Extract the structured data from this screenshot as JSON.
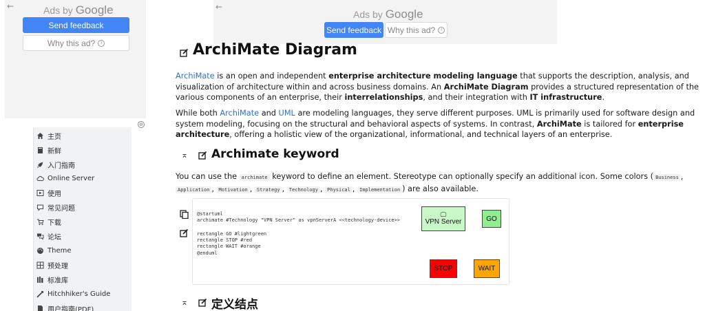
{
  "ads": {
    "left": {
      "back_glyph": "←",
      "ads_by": "Ads by",
      "google": "Google",
      "send_feedback": "Send feedback",
      "why_this_ad": "Why this ad?",
      "info_glyph": "i"
    },
    "top": {
      "back_glyph": "←",
      "ads_by": "Ads by",
      "google": "Google",
      "send_feedback": "Send feedback",
      "why_this_ad": "Why this ad?",
      "info_glyph": "i"
    }
  },
  "sidebar": {
    "toggle_glyph": "⊖",
    "items": [
      {
        "label": "主页",
        "icon": "home-icon"
      },
      {
        "label": "新鲜",
        "icon": "book-icon"
      },
      {
        "label": "入门指南",
        "icon": "rocket-icon"
      },
      {
        "label": "Online Server",
        "icon": "cloud-icon"
      },
      {
        "label": "使用",
        "icon": "play-icon"
      },
      {
        "label": "常见问题",
        "icon": "comment-icon"
      },
      {
        "label": "下载",
        "icon": "download-icon"
      },
      {
        "label": "论坛",
        "icon": "forum-icon"
      },
      {
        "label": "Theme",
        "icon": "palette-icon"
      },
      {
        "label": "预处理",
        "icon": "preprocess-icon"
      },
      {
        "label": "标准库",
        "icon": "library-icon"
      },
      {
        "label": "Hitchhiker's Guide",
        "icon": "guide-icon"
      },
      {
        "label": "用户指南(PDF)",
        "icon": "pdf-icon"
      }
    ]
  },
  "main": {
    "title": "ArchiMate Diagram",
    "p1": {
      "link": "ArchiMate",
      "t1": " is an open and independent ",
      "b1": "enterprise architecture modeling language",
      "t2": " that supports the description, analysis, and visualization of architecture within and across business domains. An ",
      "b2": "ArchiMate Diagram",
      "t3": " provides a structured representation of the various components of an enterprise, their ",
      "b3": "interrelationships",
      "t4": ", and their integration with ",
      "b4": "IT infrastructure",
      "t5": "."
    },
    "p2": {
      "t0": "While both ",
      "link1": "ArchiMate",
      "t1": " and ",
      "link2": "UML",
      "t2": " are modeling languages, they serve different purposes. UML is primarily used for software design and system modeling, focusing on the structural and behavioral aspects of systems. In contrast, ",
      "b1": "ArchiMate",
      "t3": " is tailored for ",
      "b2": "enterprise architecture",
      "t4": ", offering a holistic view of the organizational, informational, and technical layers of an enterprise."
    },
    "section1": {
      "heading": "Archimate keyword",
      "collapse_glyph": "⌅",
      "p": {
        "t0": "You can use the ",
        "code0": "archimate",
        "t1": " keyword to define an element. Stereotype can optionally specify an additional icon. Some colors (",
        "c1": "Business",
        "s1": ", ",
        "c2": "Application",
        "s2": ",",
        "c3": "Motivation",
        "s3": ", ",
        "c4": "Strategy",
        "s4": ", ",
        "c5": "Technology",
        "s5": ", ",
        "c6": "Physical",
        "s6": ", ",
        "c7": "Implementation",
        "t2": ") are also available."
      }
    },
    "example": {
      "copy_glyph": "❐",
      "edit_glyph": "✎",
      "code_lines": [
        "@startuml",
        "archimate #Technology \"VPN Server\" as vpnServerA <<technology-device>>",
        "",
        "rectangle GO #lightgreen",
        "rectangle STOP #red",
        "rectangle WAIT #orange",
        "@enduml"
      ],
      "nodes": {
        "vpn": {
          "label": "VPN Server",
          "glyph": "🖵",
          "color": "#c8f7c8"
        },
        "go": {
          "label": "GO",
          "color": "#90ee90"
        },
        "stop": {
          "label": "STOP",
          "color": "#ff0000"
        },
        "wait": {
          "label": "WAIT",
          "color": "#ffa500"
        }
      }
    },
    "section2": {
      "heading": "定义结点",
      "collapse_glyph": "⌅"
    }
  }
}
